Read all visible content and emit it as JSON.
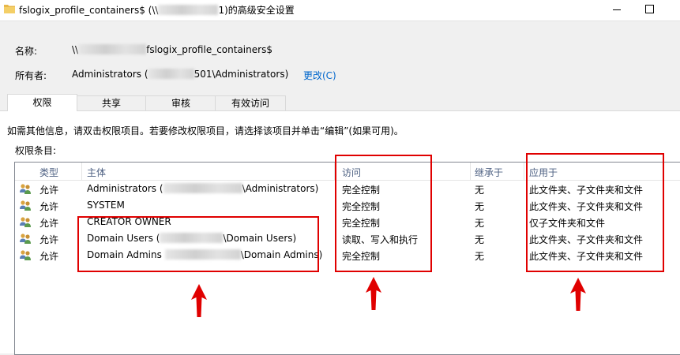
{
  "window": {
    "title_prefix": "fslogix_profile_containers$ (\\\\",
    "title_suffix": "1)的高级安全设置"
  },
  "fields": {
    "name_label": "名称:",
    "name_prefix": "\\\\",
    "name_suffix": "fslogix_profile_containers$",
    "owner_label": "所有者:",
    "owner_prefix": "Administrators (",
    "owner_suffix": "501\\Administrators)",
    "change_link": "更改(C)"
  },
  "tabs": [
    "权限",
    "共享",
    "审核",
    "有效访问"
  ],
  "info_text": "如需其他信息，请双击权限项目。若要修改权限项目，请选择该项目并单击“编辑”(如果可用)。",
  "entries_label": "权限条目:",
  "columns": [
    "类型",
    "主体",
    "访问",
    "继承于",
    "应用于"
  ],
  "rows": [
    {
      "type": "允许",
      "principal_prefix": "Administrators (",
      "principal_suffix": "\\Administrators)",
      "redacted": true,
      "access": "完全控制",
      "inherited": "无",
      "applies": "此文件夹、子文件夹和文件"
    },
    {
      "type": "允许",
      "principal_prefix": "SYSTEM",
      "principal_suffix": "",
      "redacted": false,
      "access": "完全控制",
      "inherited": "无",
      "applies": "此文件夹、子文件夹和文件"
    },
    {
      "type": "允许",
      "principal_prefix": "CREATOR OWNER",
      "principal_suffix": "",
      "redacted": false,
      "access": "完全控制",
      "inherited": "无",
      "applies": "仅子文件夹和文件"
    },
    {
      "type": "允许",
      "principal_prefix": "Domain Users (",
      "principal_suffix": "\\Domain Users)",
      "redacted": true,
      "access": "读取、写入和执行",
      "inherited": "无",
      "applies": "此文件夹、子文件夹和文件"
    },
    {
      "type": "允许",
      "principal_prefix": "Domain Admins ",
      "principal_suffix": "\\Domain Admins)",
      "redacted": true,
      "access": "完全控制",
      "inherited": "无",
      "applies": "此文件夹、子文件夹和文件"
    }
  ],
  "colors": {
    "annotation": "#e00000",
    "link": "#0066cc",
    "header_text": "#4d6082"
  }
}
